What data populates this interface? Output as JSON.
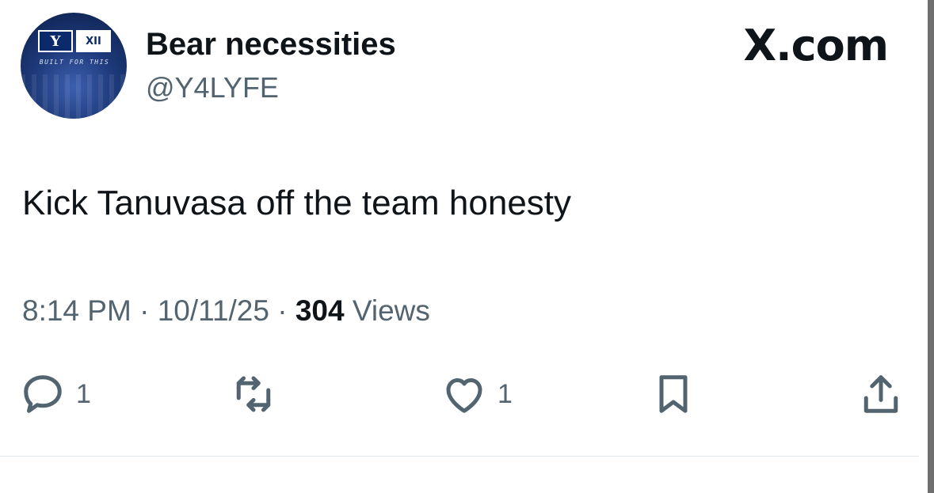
{
  "account": {
    "display_name": "Bear necessities",
    "handle": "@Y4LYFE",
    "avatar": {
      "logo_left": "Y",
      "logo_right": "XII",
      "tagline": "BUILT FOR THIS"
    }
  },
  "brand": {
    "label": "X.com"
  },
  "tweet": {
    "text": "Kick Tanuvasa off the team honesty",
    "time": "8:14 PM",
    "date": "10/11/25",
    "separator": "·",
    "views_count": "304",
    "views_label": "Views"
  },
  "actions": {
    "reply": {
      "icon": "reply-icon",
      "count": "1"
    },
    "repost": {
      "icon": "repost-icon"
    },
    "like": {
      "icon": "heart-icon",
      "count": "1"
    },
    "bookmark": {
      "icon": "bookmark-icon"
    },
    "share": {
      "icon": "share-icon"
    }
  },
  "colors": {
    "text_primary": "#0f1419",
    "text_secondary": "#536471",
    "background": "#ffffff",
    "avatar_blue": "#1e3a7a"
  }
}
